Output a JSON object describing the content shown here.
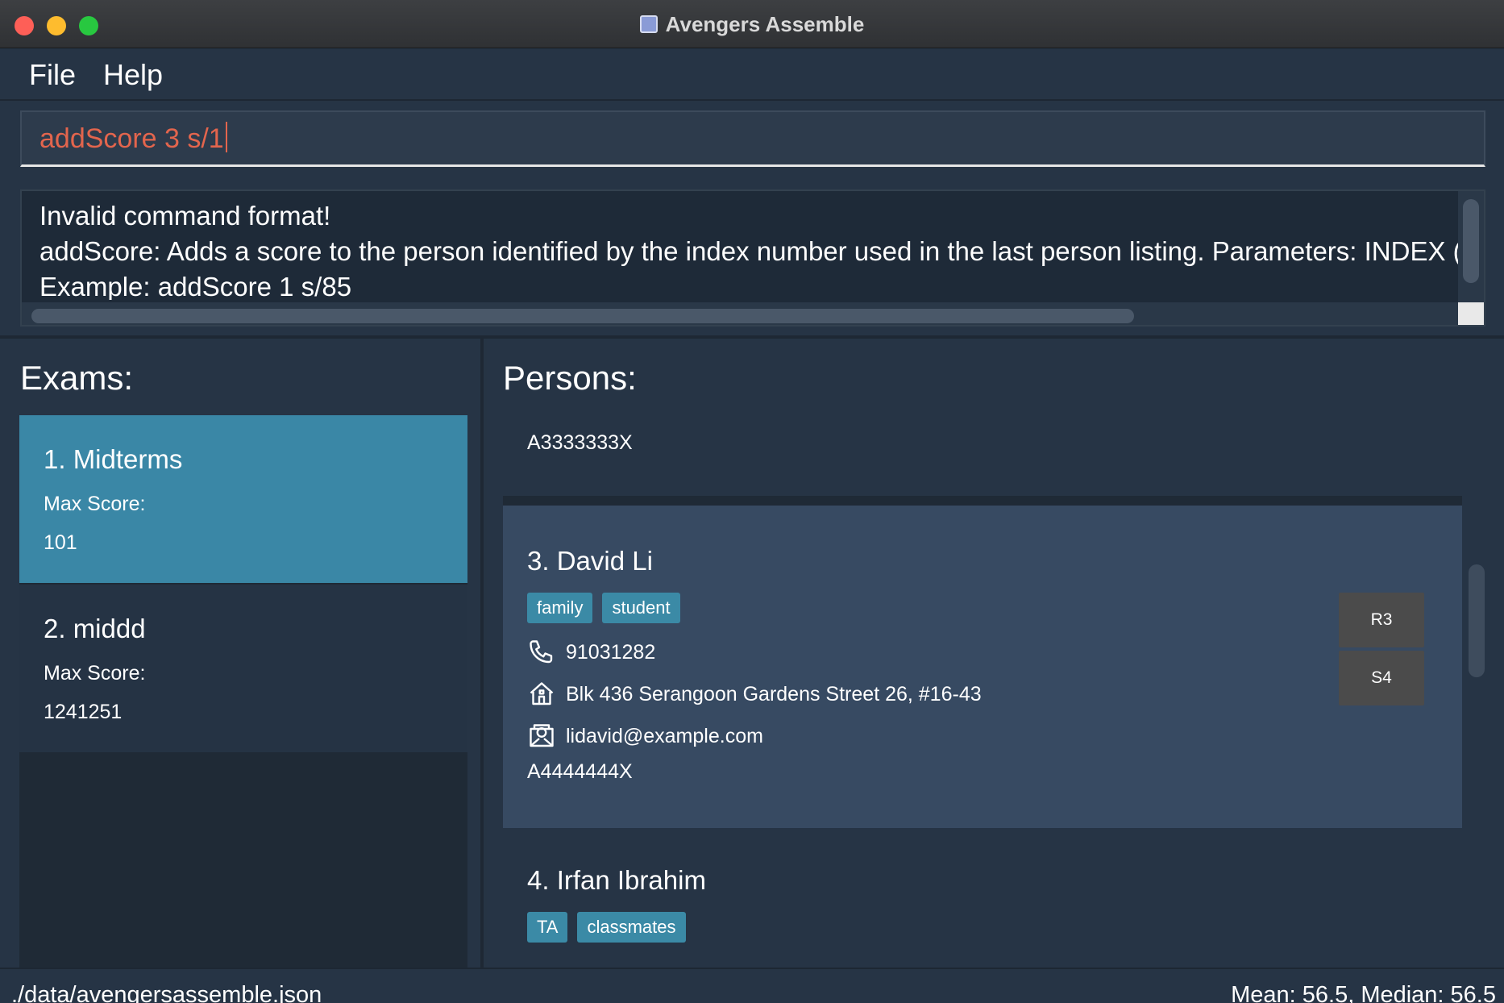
{
  "window": {
    "title": "Avengers Assemble"
  },
  "menu": {
    "file": "File",
    "help": "Help"
  },
  "command": {
    "value": "addScore 3 s/1"
  },
  "result": {
    "line1": "Invalid command format!",
    "line2": "addScore: Adds a score to the person identified by the index number used in the last person listing. Parameters: INDEX (mu",
    "line3": "Example: addScore 1 s/85"
  },
  "exams": {
    "heading": "Exams:",
    "items": [
      {
        "title": "1.  Midterms",
        "label": "Max Score:",
        "value": "101"
      },
      {
        "title": "2.  middd",
        "label": "Max Score:",
        "value": "1241251"
      }
    ]
  },
  "persons": {
    "heading": "Persons:",
    "items": [
      {
        "id": "A3333333X"
      },
      {
        "name": "3.  David Li",
        "tags": [
          "family",
          "student"
        ],
        "phone": "91031282",
        "address": "Blk 436 Serangoon Gardens Street 26, #16-43",
        "email": "lidavid@example.com",
        "id": "A4444444X",
        "buttons": [
          "R3",
          "S4"
        ]
      },
      {
        "name": "4.  Irfan Ibrahim",
        "tags": [
          "TA",
          "classmates"
        ]
      }
    ]
  },
  "status": {
    "path": "./data/avengersassemble.json",
    "stats": "Mean: 56.5, Median: 56.5"
  },
  "colors": {
    "accent": "#3a87a6",
    "command_error": "#e3654d",
    "tag": "#3b8aa6"
  }
}
